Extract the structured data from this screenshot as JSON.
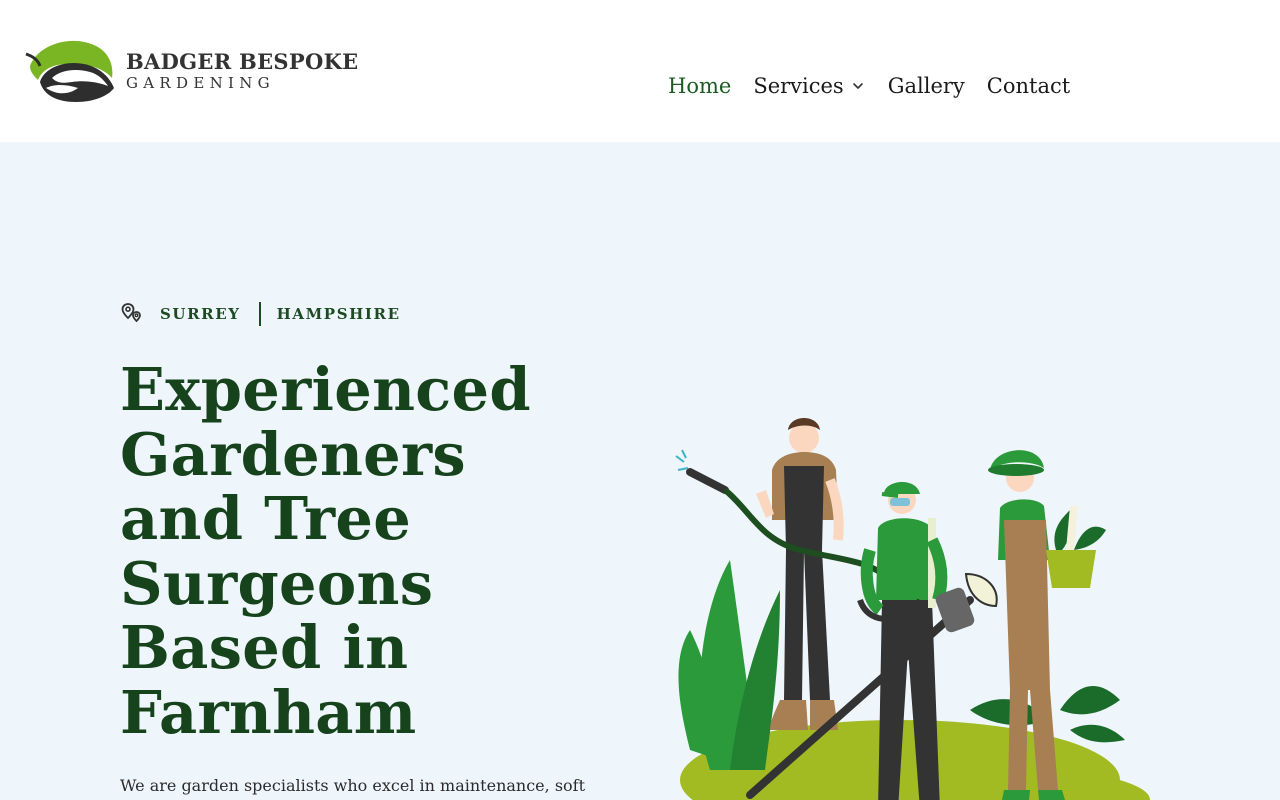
{
  "brand": {
    "name": "BADGER BESPOKE",
    "tagline": "GARDENING",
    "accent_green": "#7ab523",
    "dark_green": "#17431c"
  },
  "nav": {
    "items": [
      {
        "label": "Home",
        "active": true
      },
      {
        "label": "Services",
        "has_dropdown": true
      },
      {
        "label": "Gallery"
      },
      {
        "label": "Contact"
      }
    ],
    "active_color": "#1d5a24"
  },
  "hero": {
    "background": "#eef6fc",
    "locations": [
      "SURREY",
      "HAMPSHIRE"
    ],
    "headline_lines": [
      "Experienced",
      "Gardeners",
      "and Tree",
      "Surgeons",
      "Based in",
      "Farnham"
    ],
    "intro": "We are garden specialists who excel in maintenance, soft"
  },
  "icons": {
    "logo": "badger-leaf-logo",
    "locations": "location-pins-icon",
    "dropdown": "chevron-down-icon"
  }
}
